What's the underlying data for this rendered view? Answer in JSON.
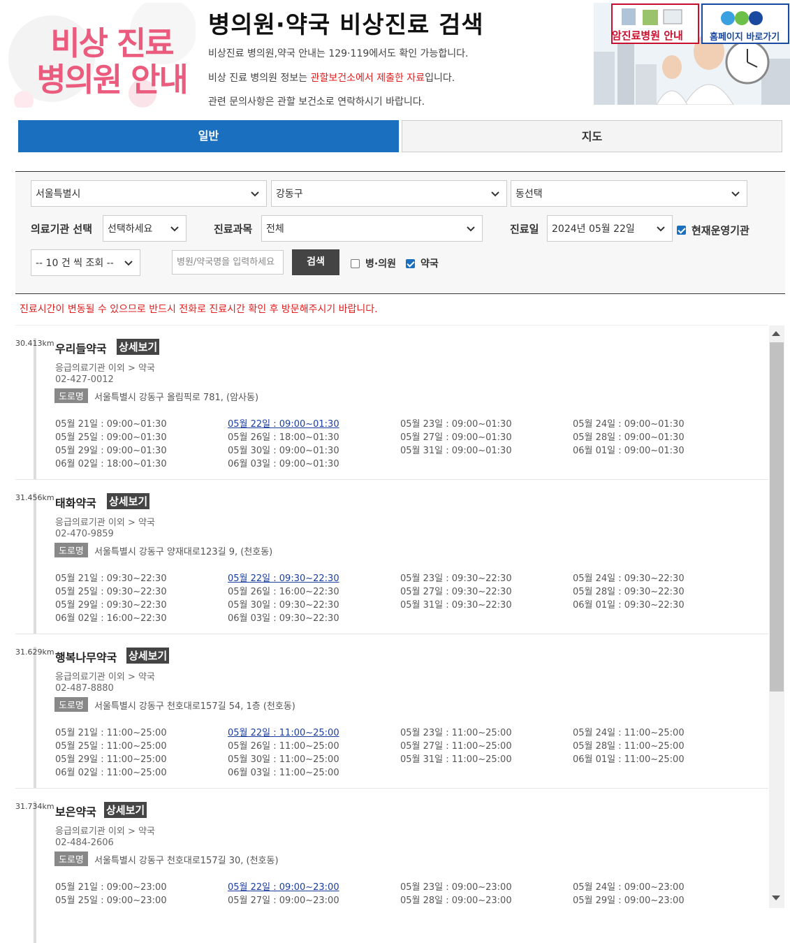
{
  "header": {
    "logo_line1": "비상 진료",
    "logo_line2": "병의원 안내",
    "title": "병의원·약국 비상진료 검색",
    "info1": "비상진료 병의원,약국 안내는 129·119에서도 확인 가능합니다.",
    "info2_pre": "비상 진료 병의원 정보는 ",
    "info2_red": "관할보건소에서 제출한 자료",
    "info2_post": "입니다.",
    "info3": "관련 문의사항은 관할 보건소로 연락하시기 바랍니다.",
    "banner_cancer": "암진료병원 안내",
    "banner_home": "홈페이지 바로가기"
  },
  "tabs": [
    {
      "label": "일반",
      "active": true
    },
    {
      "label": "지도",
      "active": false
    }
  ],
  "filters": {
    "city": "서울특별시",
    "district": "강동구",
    "dong": "동선택",
    "facility_label": "의료기관 선택",
    "facility_value": "선택하세요",
    "dept_label": "진료과목",
    "dept_value": "전체",
    "date_label": "진료일",
    "date_value": "2024년 05월 22일",
    "current_open_label": "현재운영기관",
    "current_open_checked": true,
    "page_size": "-- 10 건 씩 조회 --",
    "name_placeholder": "병원/약국명을 입력하세요",
    "search_button": "검색",
    "hospital_label": "병·의원",
    "hospital_checked": false,
    "pharmacy_label": "약국",
    "pharmacy_checked": true
  },
  "notice": "진료시간이 변동될 수 있으므로 반드시 전화로 진료시간 확인 후 방문해주시기 바랍니다.",
  "detail_label": "상세보기",
  "road_label": "도로명",
  "results": [
    {
      "distance": "30.413km",
      "name": "우리들약국",
      "category": "응급의료기관 이외 > 약국",
      "phone": "02-427-0012",
      "address": "서울특별시 강동구 올림픽로 781, (암사동)",
      "hours": [
        [
          "05월 21일 : 09:00~01:30",
          "05월 22일 : 09:00~01:30",
          "05월 23일 : 09:00~01:30",
          "05월 24일 : 09:00~01:30"
        ],
        [
          "05월 25일 : 09:00~01:30",
          "05월 26일 : 18:00~01:30",
          "05월 27일 : 09:00~01:30",
          "05월 28일 : 09:00~01:30"
        ],
        [
          "05월 29일 : 09:00~01:30",
          "05월 30일 : 09:00~01:30",
          "05월 31일 : 09:00~01:30",
          "06월 01일 : 09:00~01:30"
        ],
        [
          "06월 02일 : 18:00~01:30",
          "06월 03일 : 09:00~01:30",
          "",
          ""
        ]
      ]
    },
    {
      "distance": "31.456km",
      "name": "태화약국",
      "category": "응급의료기관 이외 > 약국",
      "phone": "02-470-9859",
      "address": "서울특별시 강동구 양재대로123길 9, (천호동)",
      "hours": [
        [
          "05월 21일 : 09:30~22:30",
          "05월 22일 : 09:30~22:30",
          "05월 23일 : 09:30~22:30",
          "05월 24일 : 09:30~22:30"
        ],
        [
          "05월 25일 : 09:30~22:30",
          "05월 26일 : 16:00~22:30",
          "05월 27일 : 09:30~22:30",
          "05월 28일 : 09:30~22:30"
        ],
        [
          "05월 29일 : 09:30~22:30",
          "05월 30일 : 09:30~22:30",
          "05월 31일 : 09:30~22:30",
          "06월 01일 : 09:30~22:30"
        ],
        [
          "06월 02일 : 16:00~22:30",
          "06월 03일 : 09:30~22:30",
          "",
          ""
        ]
      ]
    },
    {
      "distance": "31.629km",
      "name": "행복나무약국",
      "category": "응급의료기관 이외 > 약국",
      "phone": "02-487-8880",
      "address": "서울특별시 강동구 천호대로157길 54, 1층 (천호동)",
      "hours": [
        [
          "05월 21일 : 11:00~25:00",
          "05월 22일 : 11:00~25:00",
          "05월 23일 : 11:00~25:00",
          "05월 24일 : 11:00~25:00"
        ],
        [
          "05월 25일 : 11:00~25:00",
          "05월 26일 : 11:00~25:00",
          "05월 27일 : 11:00~25:00",
          "05월 28일 : 11:00~25:00"
        ],
        [
          "05월 29일 : 11:00~25:00",
          "05월 30일 : 11:00~25:00",
          "05월 31일 : 11:00~25:00",
          "06월 01일 : 11:00~25:00"
        ],
        [
          "06월 02일 : 11:00~25:00",
          "06월 03일 : 11:00~25:00",
          "",
          ""
        ]
      ]
    },
    {
      "distance": "31.734km",
      "name": "보은약국",
      "category": "응급의료기관 이외 > 약국",
      "phone": "02-484-2606",
      "address": "서울특별시 강동구 천호대로157길 30, (천호동)",
      "hours": [
        [
          "05월 21일 : 09:00~23:00",
          "05월 22일 : 09:00~23:00",
          "05월 23일 : 09:00~23:00",
          "05월 24일 : 09:00~23:00"
        ],
        [
          "05월 25일 : 09:00~23:00",
          "05월 27일 : 09:00~23:00",
          "05월 28일 : 09:00~23:00",
          "05월 29일 : 09:00~23:00"
        ]
      ]
    }
  ],
  "colors": {
    "primary": "#1a70bf",
    "logo_pink": "#ea5b7d",
    "alert_red": "#e02020",
    "today_link": "#1a3d9e"
  }
}
